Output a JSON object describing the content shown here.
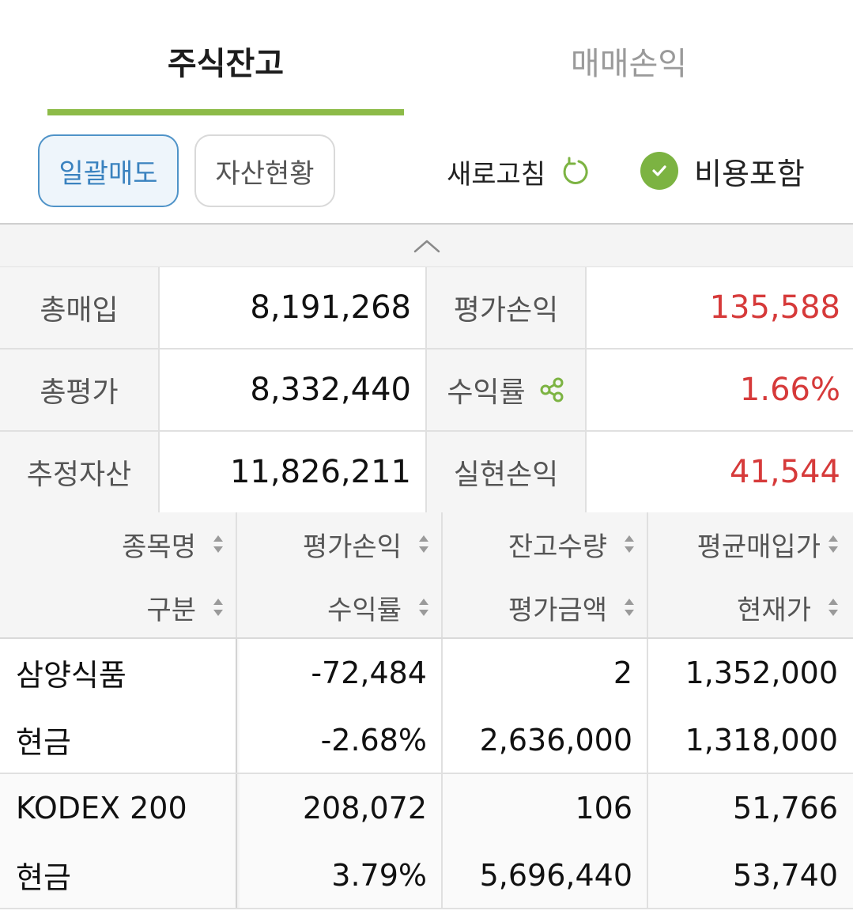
{
  "tabs": [
    {
      "label": "주식잔고",
      "active": true
    },
    {
      "label": "매매손익",
      "active": false
    }
  ],
  "toolbar": {
    "bulk_sell_label": "일괄매도",
    "asset_status_label": "자산현황",
    "refresh_label": "새로고침",
    "include_cost_label": "비용포함",
    "include_cost_checked": true
  },
  "summary": {
    "total_purchase_label": "총매입",
    "total_purchase_value": "8,191,268",
    "eval_pl_label": "평가손익",
    "eval_pl_value": "135,588",
    "total_eval_label": "총평가",
    "total_eval_value": "8,332,440",
    "return_rate_label": "수익률",
    "return_rate_value": "1.66%",
    "est_assets_label": "추정자산",
    "est_assets_value": "11,826,211",
    "realized_pl_label": "실현손익",
    "realized_pl_value": "41,544"
  },
  "table": {
    "headers": {
      "row1": [
        "종목명",
        "평가손익",
        "잔고수량",
        "평균매입가"
      ],
      "row2": [
        "구분",
        "수익률",
        "평가금액",
        "현재가"
      ]
    },
    "rows": [
      {
        "name": "삼양식품",
        "type": "현금",
        "eval_pl": "-72,484",
        "return_rate": "-2.68%",
        "quantity": "2",
        "eval_amount": "2,636,000",
        "avg_price": "1,352,000",
        "current_price": "1,318,000"
      },
      {
        "name": "KODEX 200",
        "type": "현금",
        "eval_pl": "208,072",
        "return_rate": "3.79%",
        "quantity": "106",
        "eval_amount": "5,696,440",
        "avg_price": "51,766",
        "current_price": "53,740"
      }
    ]
  },
  "colors": {
    "accent_green": "#8dbb48",
    "positive_red": "#d63a3a",
    "negative_blue": "#3b86c6",
    "primary_button_blue": "#4f93c8"
  },
  "icons": {
    "refresh": "refresh-icon",
    "check": "check-circle-icon",
    "share": "share-icon",
    "collapse": "chevron-up-icon",
    "sort": "sort-icon"
  }
}
